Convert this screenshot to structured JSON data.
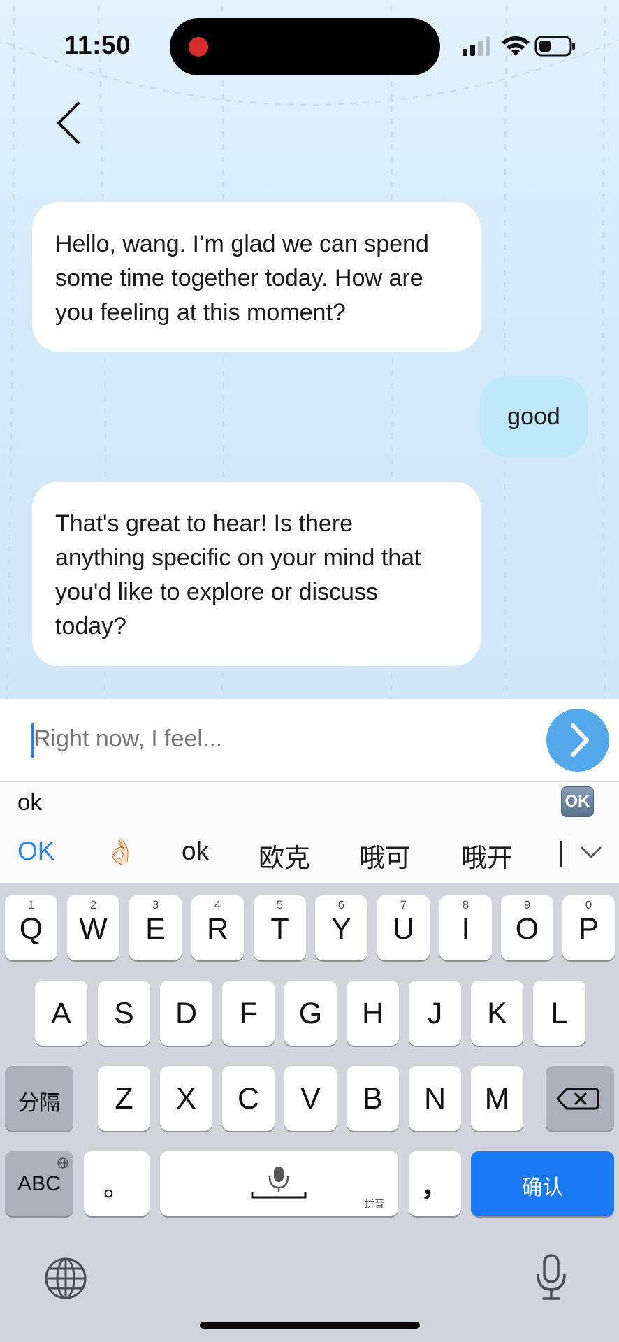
{
  "status_bar": {
    "time": "11:50"
  },
  "messages": [
    {
      "role": "assistant",
      "lines": [
        "Hello, wang. I’m glad we can spend",
        "some time together today. How are",
        "you feeling at this moment?"
      ]
    },
    {
      "role": "user",
      "text": "good"
    },
    {
      "role": "assistant",
      "lines": [
        "That's great to hear! Is there",
        "anything specific on your mind that",
        "you'd like to explore or discuss",
        "today?"
      ]
    }
  ],
  "input": {
    "placeholder": "Right now, I feel...",
    "value": ""
  },
  "ime": {
    "pinyin": "ok",
    "emoji_badge": "OK",
    "candidates": [
      "OK",
      "👌🏻",
      "ok",
      "欧克",
      "哦可",
      "哦开"
    ]
  },
  "keyboard": {
    "row1": [
      {
        "letter": "Q",
        "num": "1"
      },
      {
        "letter": "W",
        "num": "2"
      },
      {
        "letter": "E",
        "num": "3"
      },
      {
        "letter": "R",
        "num": "4"
      },
      {
        "letter": "T",
        "num": "5"
      },
      {
        "letter": "Y",
        "num": "6"
      },
      {
        "letter": "U",
        "num": "7"
      },
      {
        "letter": "I",
        "num": "8"
      },
      {
        "letter": "O",
        "num": "9"
      },
      {
        "letter": "P",
        "num": "0"
      }
    ],
    "row2": [
      "A",
      "S",
      "D",
      "F",
      "G",
      "H",
      "J",
      "K",
      "L"
    ],
    "row3": [
      "Z",
      "X",
      "C",
      "V",
      "B",
      "N",
      "M"
    ],
    "separator_label": "分隔",
    "abc_label": "ABC",
    "period_label": "。",
    "space_hint": "拼音",
    "comma_label": "，",
    "confirm_label": "确认"
  },
  "colors": {
    "send_button": "#52a8ea",
    "user_bubble": "#bde9fb",
    "confirm_key": "#1a79f4",
    "recording_dot": "#d92d2b"
  }
}
